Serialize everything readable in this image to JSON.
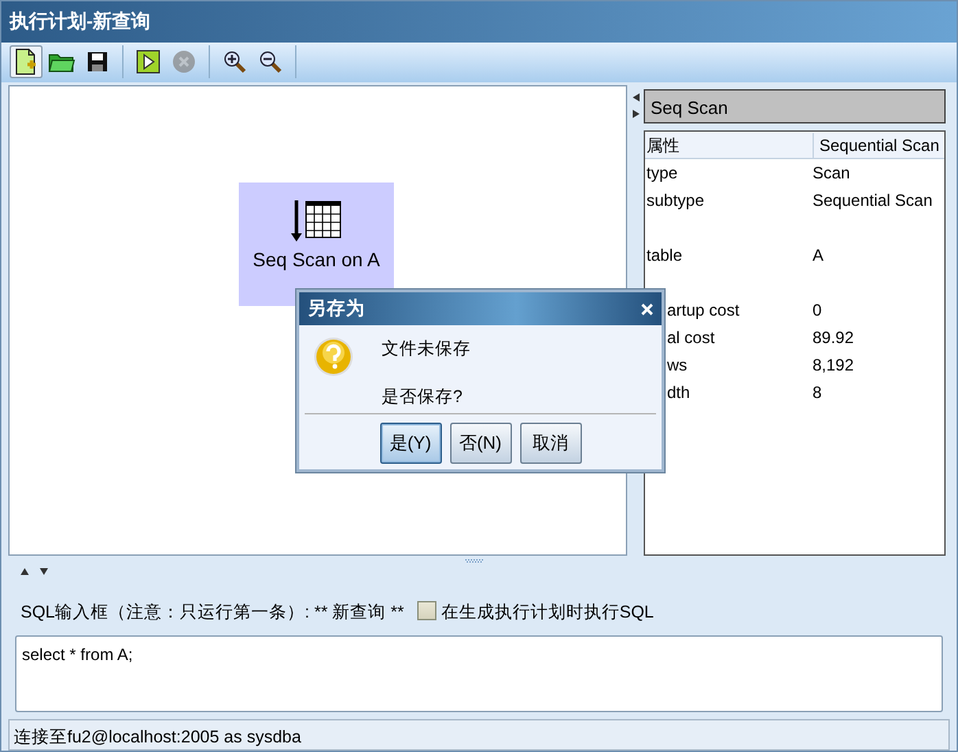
{
  "window": {
    "title": "执行计划-新查询"
  },
  "toolbar": [
    {
      "kind": "new",
      "pressed": true,
      "disabled": false
    },
    {
      "kind": "open",
      "pressed": false,
      "disabled": false
    },
    {
      "kind": "save",
      "pressed": false,
      "disabled": false
    },
    {
      "kind": "sep"
    },
    {
      "kind": "run",
      "pressed": false,
      "disabled": false
    },
    {
      "kind": "stop",
      "pressed": false,
      "disabled": true
    },
    {
      "kind": "sep"
    },
    {
      "kind": "zoom-in",
      "pressed": false,
      "disabled": false
    },
    {
      "kind": "zoom-out",
      "pressed": false,
      "disabled": false
    },
    {
      "kind": "sep"
    }
  ],
  "plan": {
    "node": {
      "label": "Seq Scan on A",
      "selected": true
    }
  },
  "properties": {
    "title": "Seq Scan",
    "columns": [
      "属性",
      "Sequential Scan"
    ],
    "rows": [
      {
        "kind": "full",
        "name": "type",
        "value": "Scan"
      },
      {
        "kind": "full",
        "name": "subtype",
        "value": "Sequential Scan"
      },
      {
        "kind": "blank"
      },
      {
        "kind": "full",
        "name": "table",
        "value": "A"
      },
      {
        "kind": "blank"
      },
      {
        "kind": "partial",
        "name": "artup cost",
        "value": "0"
      },
      {
        "kind": "partial",
        "name": "al cost",
        "value": "89.92"
      },
      {
        "kind": "partial",
        "name": "ws",
        "value": "8,192"
      },
      {
        "kind": "partial",
        "name": "dth",
        "value": "8"
      }
    ]
  },
  "sql": {
    "label": "SQL输入框（注意：只运行第一条）: ** 新查询 **",
    "checkbox": {
      "label": "在生成执行计划时执行SQL",
      "checked": false
    },
    "value": "select * from A;"
  },
  "status_bar": "连接至fu2@localhost:2005 as sysdba",
  "dialog": {
    "title": "另存为",
    "lines": [
      "文件未保存",
      "是否保存?"
    ],
    "buttons": [
      {
        "label": "是(Y)",
        "selected": true
      },
      {
        "label": "否(N)",
        "selected": false
      },
      {
        "label": "取消",
        "selected": false
      }
    ]
  }
}
